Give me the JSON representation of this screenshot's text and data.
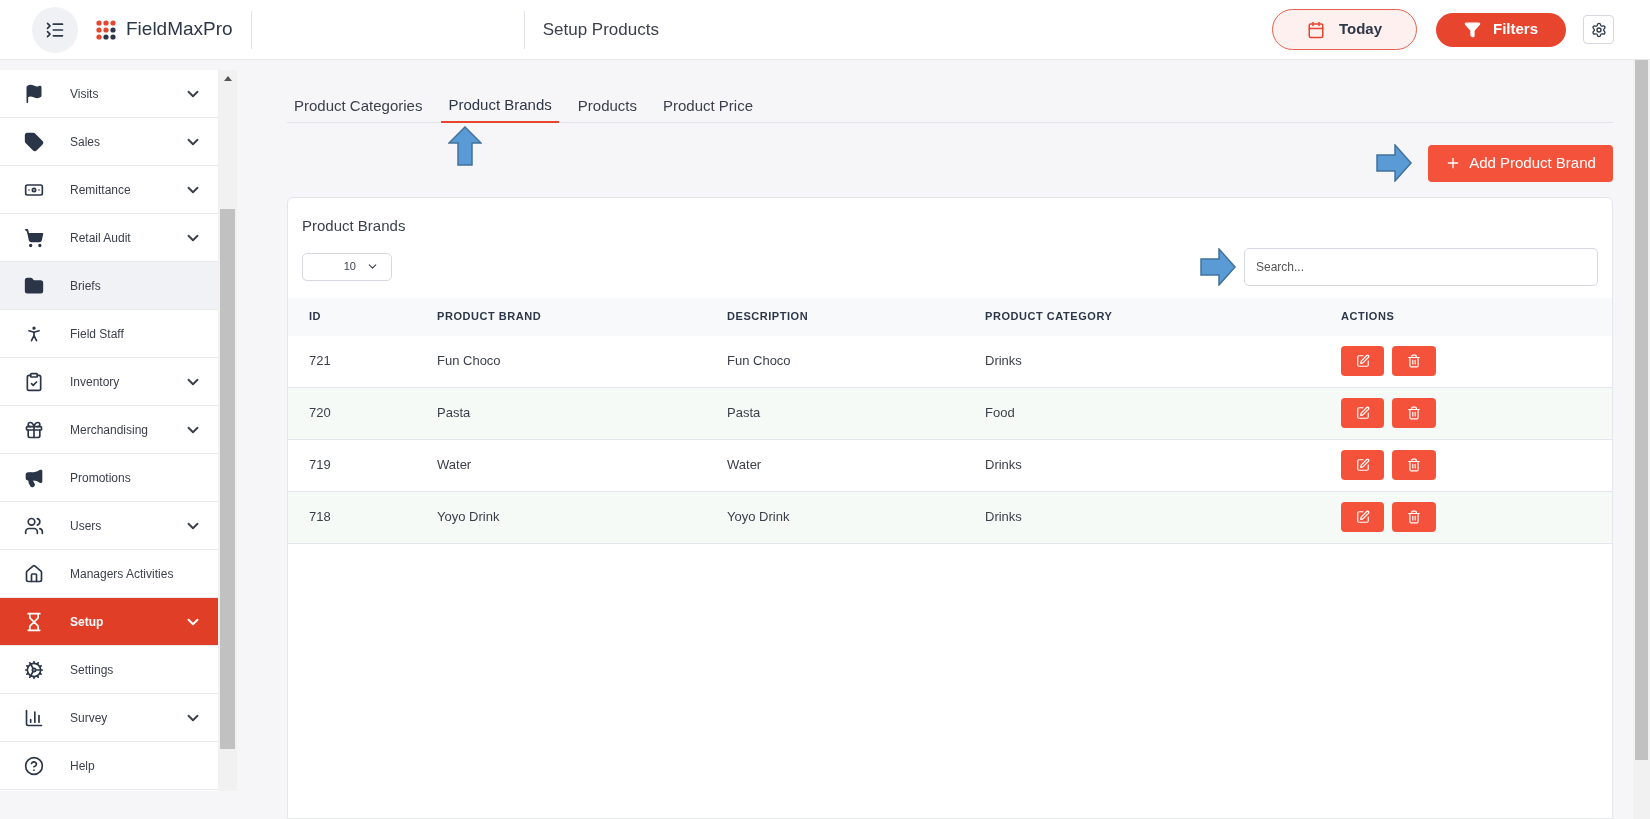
{
  "header": {
    "brand": "FieldMaxPro",
    "page_title": "Setup Products",
    "today_button": "Today",
    "filters_button": "Filters"
  },
  "sidebar": {
    "items": [
      {
        "label": "Visits",
        "expandable": true,
        "selected": false,
        "hovered": false
      },
      {
        "label": "Sales",
        "expandable": true,
        "selected": false,
        "hovered": false
      },
      {
        "label": "Remittance",
        "expandable": true,
        "selected": false,
        "hovered": false
      },
      {
        "label": "Retail Audit",
        "expandable": true,
        "selected": false,
        "hovered": false
      },
      {
        "label": "Briefs",
        "expandable": false,
        "selected": false,
        "hovered": true
      },
      {
        "label": "Field Staff",
        "expandable": false,
        "selected": false,
        "hovered": false
      },
      {
        "label": "Inventory",
        "expandable": true,
        "selected": false,
        "hovered": false
      },
      {
        "label": "Merchandising",
        "expandable": true,
        "selected": false,
        "hovered": false
      },
      {
        "label": "Promotions",
        "expandable": false,
        "selected": false,
        "hovered": false
      },
      {
        "label": "Users",
        "expandable": true,
        "selected": false,
        "hovered": false
      },
      {
        "label": "Managers Activities",
        "expandable": false,
        "selected": false,
        "hovered": false
      },
      {
        "label": "Setup",
        "expandable": true,
        "selected": true,
        "hovered": false
      },
      {
        "label": "Settings",
        "expandable": false,
        "selected": false,
        "hovered": false
      },
      {
        "label": "Survey",
        "expandable": true,
        "selected": false,
        "hovered": false
      },
      {
        "label": "Help",
        "expandable": false,
        "selected": false,
        "hovered": false
      }
    ]
  },
  "tabs": [
    {
      "label": "Product Categories",
      "selected": false
    },
    {
      "label": "Product Brands",
      "selected": true
    },
    {
      "label": "Products",
      "selected": false
    },
    {
      "label": "Product Price",
      "selected": false
    }
  ],
  "add_button": "Add Product Brand",
  "card": {
    "title": "Product Brands",
    "page_size": "10",
    "search": {
      "placeholder": "Search..."
    },
    "table": {
      "columns": [
        "ID",
        "PRODUCT BRAND",
        "DESCRIPTION",
        "PRODUCT CATEGORY",
        "ACTIONS"
      ],
      "rows": [
        {
          "id": "721",
          "brand": "Fun Choco",
          "description": "Fun Choco",
          "category": "Drinks"
        },
        {
          "id": "720",
          "brand": "Pasta",
          "description": "Pasta",
          "category": "Food"
        },
        {
          "id": "719",
          "brand": "Water",
          "description": "Water",
          "category": "Drinks"
        },
        {
          "id": "718",
          "brand": "Yoyo Drink",
          "description": "Yoyo Drink",
          "category": "Drinks"
        }
      ]
    }
  }
}
